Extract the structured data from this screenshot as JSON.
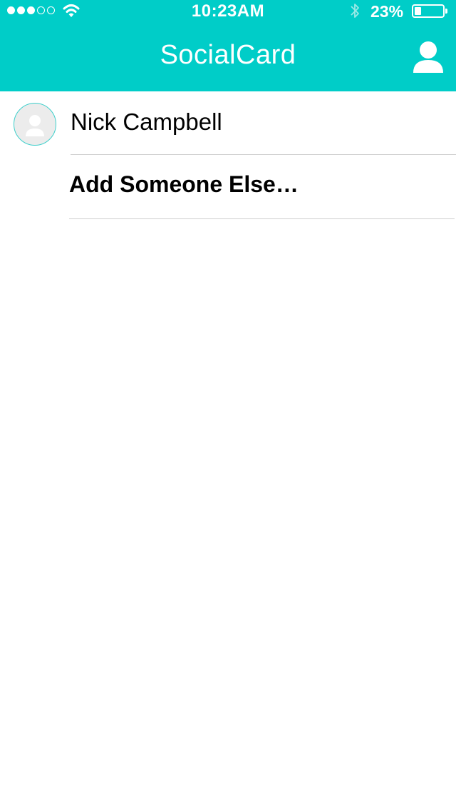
{
  "status_bar": {
    "signal_strength": "3 of 5",
    "wifi_icon": "wifi-icon",
    "time": "10:23AM",
    "bluetooth_icon": "bluetooth-icon",
    "battery_percent": "23%",
    "battery_level": 0.23
  },
  "nav_bar": {
    "title": "SocialCard",
    "right_icon": "person-icon"
  },
  "contacts": [
    {
      "name": "Nick Campbell",
      "avatar_icon": "avatar-placeholder-icon"
    }
  ],
  "add_someone_label": "Add Someone Else…",
  "colors": {
    "accent": "#00cdc8",
    "avatar_border": "#3fd0cc",
    "divider": "#cfcfcf"
  }
}
